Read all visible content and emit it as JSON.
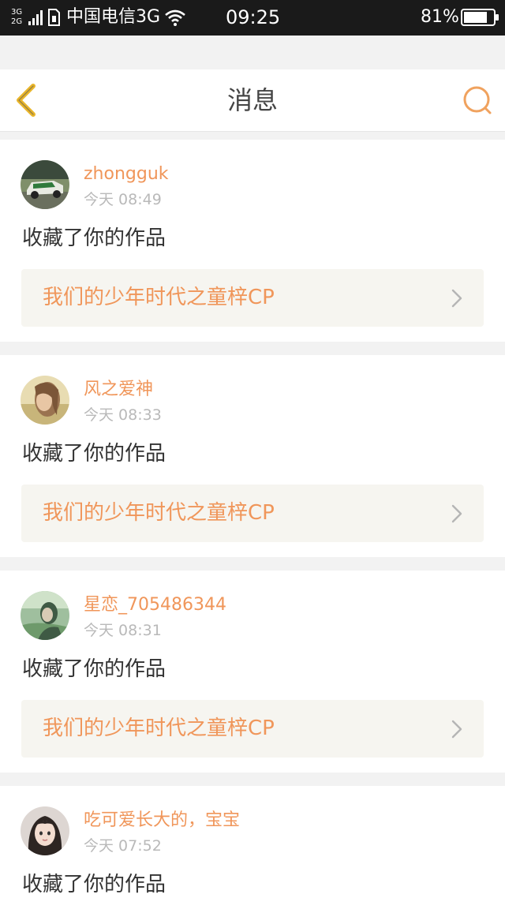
{
  "status_bar": {
    "network_top": "3G",
    "network_bottom": "2G",
    "carrier": "中国电信3G",
    "time": "09:25",
    "battery_percent": "81%",
    "battery_level": 0.81
  },
  "header": {
    "title": "消息",
    "back_icon": "chevron-left-icon",
    "search_icon": "search-icon"
  },
  "colors": {
    "accent": "#f0965a",
    "back_icon": "#e9b52a",
    "card_bg": "#ffffff",
    "work_bg": "#f6f5f0",
    "page_bg": "#f2f2f2"
  },
  "messages": [
    {
      "user": "zhongguk",
      "time": "今天 08:49",
      "action": "收藏了你的作品",
      "work_title": "我们的少年时代之童梓CP"
    },
    {
      "user": "风之爱神",
      "time": "今天 08:33",
      "action": "收藏了你的作品",
      "work_title": "我们的少年时代之童梓CP"
    },
    {
      "user": "星恋_705486344",
      "time": "今天 08:31",
      "action": "收藏了你的作品",
      "work_title": "我们的少年时代之童梓CP"
    },
    {
      "user": "吃可爱长大的，宝宝",
      "time": "今天 07:52",
      "action": "收藏了你的作品",
      "work_title": ""
    }
  ]
}
